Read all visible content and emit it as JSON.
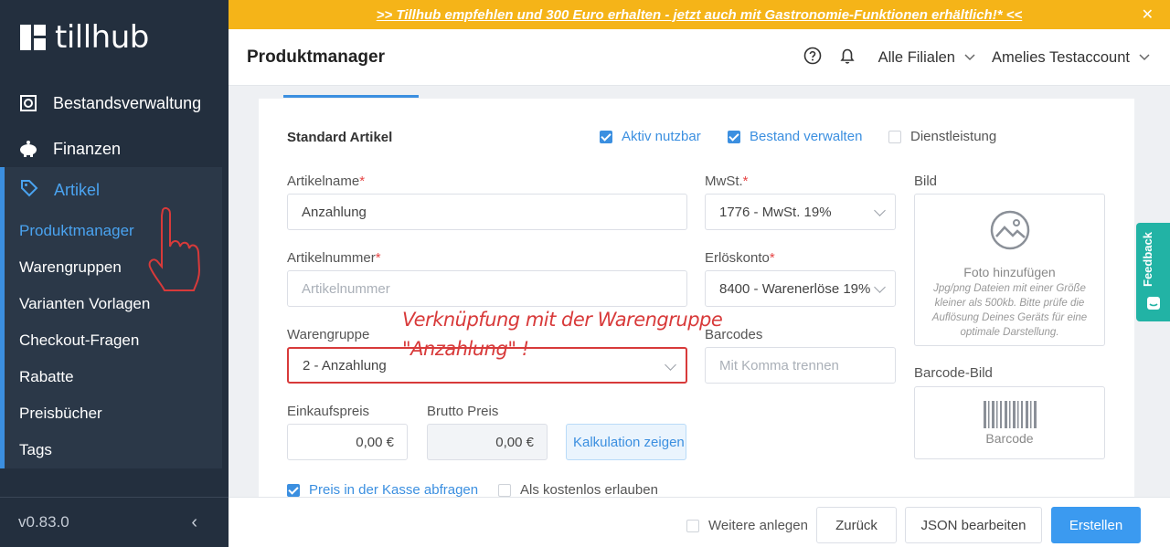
{
  "app": {
    "logo_text": "tillhub",
    "version": "v0.83.0"
  },
  "sidebar": {
    "top_items": [
      {
        "label": "Bestandsverwaltung",
        "icon": "warehouse-icon"
      },
      {
        "label": "Finanzen",
        "icon": "piggy-bank-icon"
      }
    ],
    "section": {
      "label": "Artikel",
      "icon": "tag-icon"
    },
    "sub_items": [
      {
        "label": "Produktmanager",
        "active": true
      },
      {
        "label": "Warengruppen"
      },
      {
        "label": "Varianten Vorlagen"
      },
      {
        "label": "Checkout-Fragen"
      },
      {
        "label": "Rabatte"
      },
      {
        "label": "Preisbücher"
      },
      {
        "label": "Tags"
      }
    ]
  },
  "banner": {
    "text": ">> Tillhub empfehlen und 300 Euro erhalten - jetzt auch mit Gastronomie-Funktionen erhältlich!* <<",
    "close": "✕"
  },
  "header": {
    "title": "Produktmanager",
    "branch": "Alle Filialen",
    "account": "Amelies Testaccount"
  },
  "form": {
    "section_title": "Standard Artikel",
    "checkboxes": {
      "active": {
        "label": "Aktiv nutzbar",
        "checked": true
      },
      "stock": {
        "label": "Bestand verwalten",
        "checked": true
      },
      "service": {
        "label": "Dienstleistung",
        "checked": false
      }
    },
    "name": {
      "label": "Artikelname",
      "required": "*",
      "value": "Anzahlung"
    },
    "vat": {
      "label": "MwSt.",
      "required": "*",
      "value": "1776 - MwSt. 19%"
    },
    "number": {
      "label": "Artikelnummer",
      "required": "*",
      "placeholder": "Artikelnummer"
    },
    "revenue": {
      "label": "Erlöskonto",
      "required": "*",
      "value": "8400 - Warenerlöse 19%"
    },
    "group": {
      "label": "Warengruppe",
      "value": "2 - Anzahlung"
    },
    "barcodes": {
      "label": "Barcodes",
      "placeholder": "Mit Komma trennen"
    },
    "purchase_price": {
      "label": "Einkaufspreis",
      "value": "0,00 €"
    },
    "gross_price": {
      "label": "Brutto Preis",
      "value": "0,00 €"
    },
    "calc_button": "Kalkulation zeigen",
    "ask_price": {
      "label": "Preis in der Kasse abfragen",
      "checked": true
    },
    "free": {
      "label": "Als kostenlos erlauben",
      "checked": false
    },
    "image": {
      "label": "Bild",
      "add": "Foto hinzufügen",
      "hint": "Jpg/png Dateien mit einer Größe kleiner als 500kb. Bitte prüfe die Auflösung Deines Geräts für eine optimale Darstellung."
    },
    "barcode_image": {
      "label": "Barcode-Bild",
      "caption": "Barcode"
    }
  },
  "annotation": {
    "line1": "Verknüpfung mit der Warengruppe",
    "line2": "\"Anzahlung\" !"
  },
  "footer": {
    "another": "Weitere anlegen",
    "back": "Zurück",
    "json": "JSON bearbeiten",
    "create": "Erstellen"
  },
  "feedback": "Feedback",
  "colors": {
    "sidebar": "#232f3e",
    "accent": "#3b8fe0",
    "banner": "#f5b418",
    "annotation": "#d83a3a",
    "feedback": "#22b3a5"
  }
}
